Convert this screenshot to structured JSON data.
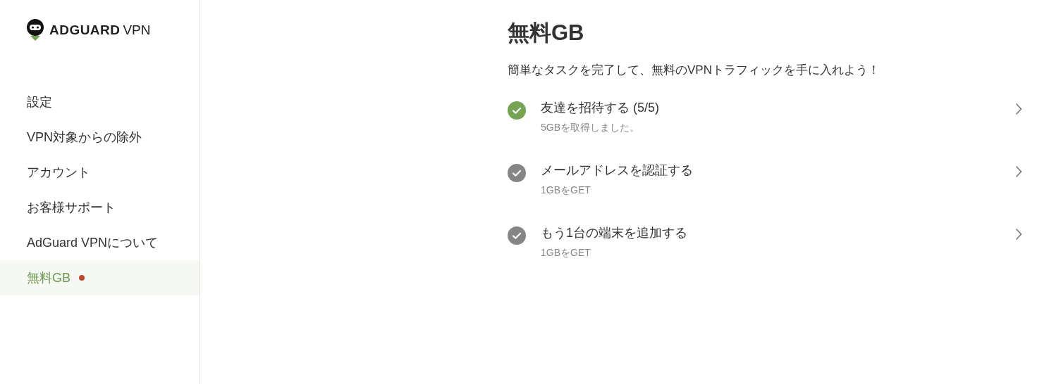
{
  "logo": {
    "brand": "ADGUARD",
    "product": "VPN"
  },
  "sidebar": {
    "items": [
      {
        "label": "設定",
        "selected": false,
        "dot": false
      },
      {
        "label": "VPN対象からの除外",
        "selected": false,
        "dot": false
      },
      {
        "label": "アカウント",
        "selected": false,
        "dot": false
      },
      {
        "label": "お客様サポート",
        "selected": false,
        "dot": false
      },
      {
        "label": "AdGuard VPNについて",
        "selected": false,
        "dot": false
      },
      {
        "label": "無料GB",
        "selected": true,
        "dot": true
      }
    ]
  },
  "main": {
    "title": "無料GB",
    "subtitle": "簡単なタスクを完了して、無料のVPNトラフィックを手に入れよう！",
    "tasks": [
      {
        "title": "友達を招待する (5/5)",
        "detail": "5GBを取得しました。",
        "completed": true
      },
      {
        "title": "メールアドレスを認証する",
        "detail": "1GBをGET",
        "completed": false
      },
      {
        "title": "もう1台の端末を追加する",
        "detail": "1GBをGET",
        "completed": false
      }
    ]
  }
}
